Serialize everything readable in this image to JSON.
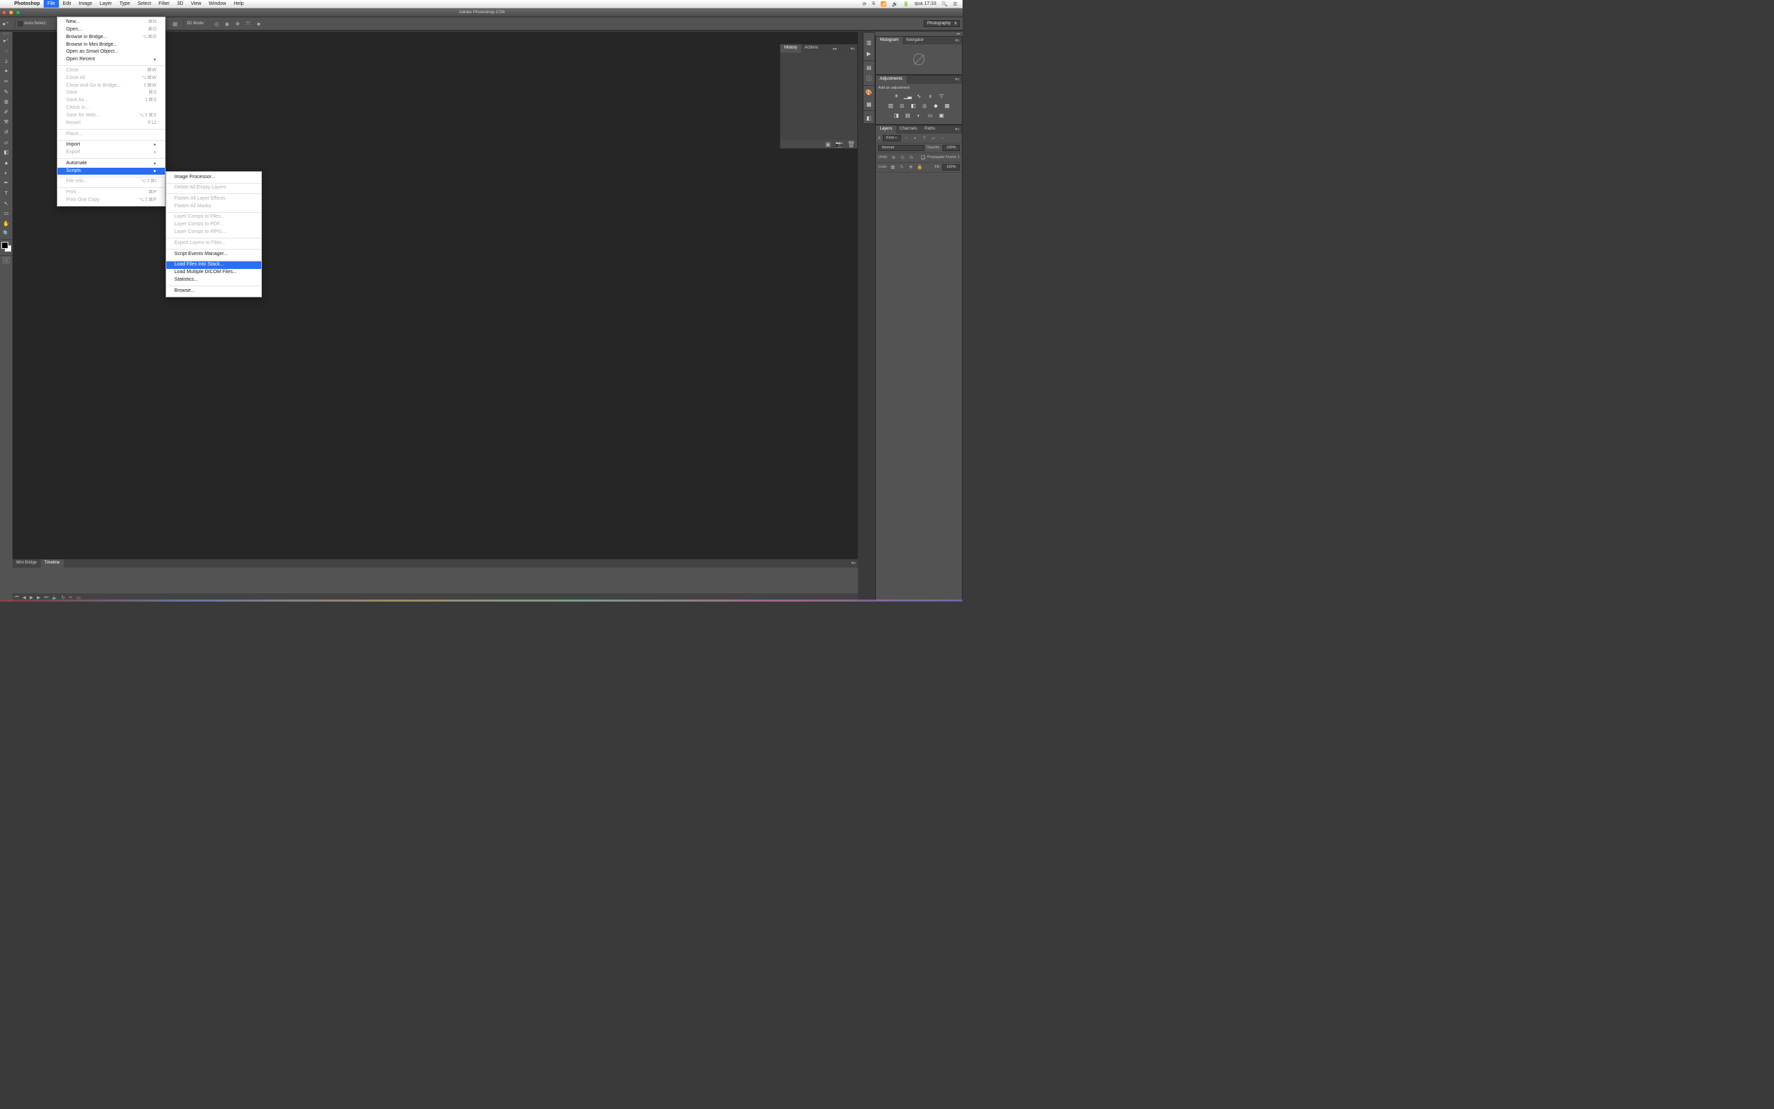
{
  "menubar": {
    "app": "Photoshop",
    "items": [
      "File",
      "Edit",
      "Image",
      "Layer",
      "Type",
      "Select",
      "Filter",
      "3D",
      "View",
      "Window",
      "Help"
    ],
    "active_index": 0,
    "status_time": "qua 17:33"
  },
  "window": {
    "title": "Adobe Photoshop CS6"
  },
  "options_bar": {
    "auto_select": "Auto-Select:",
    "mode3d": "3D Mode:",
    "workspace": "Photography"
  },
  "file_menu": [
    {
      "label": "New...",
      "shortcut": "⌘N"
    },
    {
      "label": "Open...",
      "shortcut": "⌘O"
    },
    {
      "label": "Browse in Bridge...",
      "shortcut": "⌥⌘O"
    },
    {
      "label": "Browse in Mini Bridge..."
    },
    {
      "label": "Open as Smart Object..."
    },
    {
      "label": "Open Recent",
      "submenu": true
    },
    {
      "sep": true
    },
    {
      "label": "Close",
      "shortcut": "⌘W",
      "disabled": true
    },
    {
      "label": "Close All",
      "shortcut": "⌥⌘W",
      "disabled": true
    },
    {
      "label": "Close and Go to Bridge...",
      "shortcut": "⇧⌘W",
      "disabled": true
    },
    {
      "label": "Save",
      "shortcut": "⌘S",
      "disabled": true
    },
    {
      "label": "Save As...",
      "shortcut": "⇧⌘S",
      "disabled": true
    },
    {
      "label": "Check In...",
      "disabled": true
    },
    {
      "label": "Save for Web...",
      "shortcut": "⌥⇧⌘S",
      "disabled": true
    },
    {
      "label": "Revert",
      "shortcut": "F12",
      "disabled": true
    },
    {
      "sep": true
    },
    {
      "label": "Place...",
      "disabled": true
    },
    {
      "sep": true
    },
    {
      "label": "Import",
      "submenu": true
    },
    {
      "label": "Export",
      "submenu": true,
      "disabled": true
    },
    {
      "sep": true
    },
    {
      "label": "Automate",
      "submenu": true
    },
    {
      "label": "Scripts",
      "submenu": true,
      "highlight": true
    },
    {
      "sep": true
    },
    {
      "label": "File Info...",
      "shortcut": "⌥⇧⌘I",
      "disabled": true
    },
    {
      "sep": true
    },
    {
      "label": "Print...",
      "shortcut": "⌘P",
      "disabled": true
    },
    {
      "label": "Print One Copy",
      "shortcut": "⌥⇧⌘P",
      "disabled": true
    }
  ],
  "scripts_menu": [
    {
      "label": "Image Processor..."
    },
    {
      "sep": true
    },
    {
      "label": "Delete All Empty Layers",
      "disabled": true
    },
    {
      "sep": true
    },
    {
      "label": "Flatten All Layer Effects",
      "disabled": true
    },
    {
      "label": "Flatten All Masks",
      "disabled": true
    },
    {
      "sep": true
    },
    {
      "label": "Layer Comps to Files...",
      "disabled": true
    },
    {
      "label": "Layer Comps to PDF...",
      "disabled": true
    },
    {
      "label": "Layer Comps to WPG...",
      "disabled": true
    },
    {
      "sep": true
    },
    {
      "label": "Export Layers to Files...",
      "disabled": true
    },
    {
      "sep": true
    },
    {
      "label": "Script Events Manager..."
    },
    {
      "sep": true
    },
    {
      "label": "Load Files into Stack...",
      "highlight": true
    },
    {
      "label": "Load Multiple DICOM Files..."
    },
    {
      "label": "Statistics..."
    },
    {
      "sep": true
    },
    {
      "label": "Browse..."
    }
  ],
  "panels": {
    "history_tabs": [
      "History",
      "Actions"
    ],
    "histogram_tabs": [
      "Histogram",
      "Navigator"
    ],
    "adjustments_tab": "Adjustments",
    "adjustments_label": "Add an adjustment",
    "layers_tabs": [
      "Layers",
      "Channels",
      "Paths"
    ],
    "layers": {
      "kind": "Kind",
      "blend": "Normal",
      "opacity_label": "Opacity:",
      "opacity_value": "100%",
      "unify": "Unify:",
      "propagate": "Propagate Frame 1",
      "lock": "Lock:",
      "fill_label": "Fill:",
      "fill_value": "100%"
    },
    "bottom_tabs": [
      "Mini Bridge",
      "Timeline"
    ]
  }
}
